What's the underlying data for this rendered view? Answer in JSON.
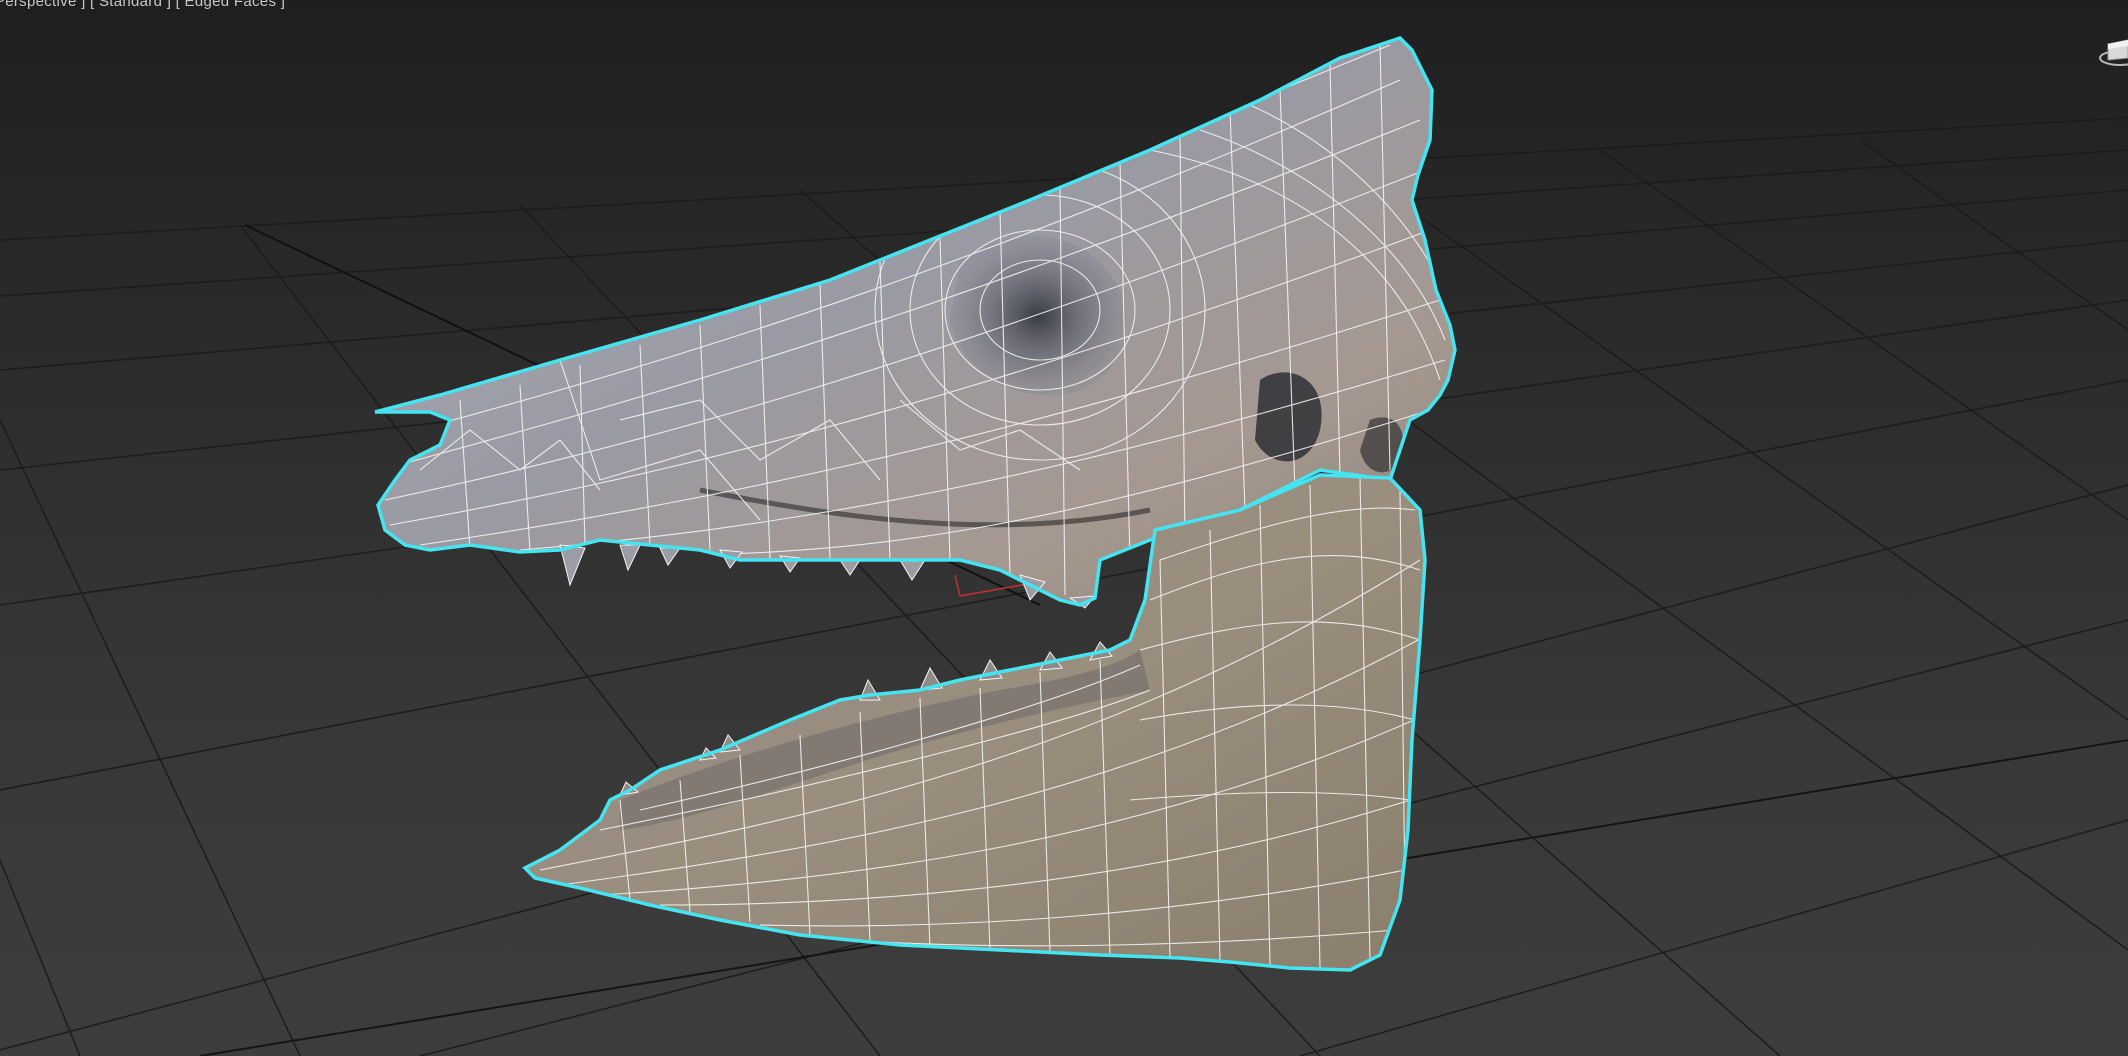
{
  "viewport": {
    "label": "[ Perspective ] [ Standard ] [ Edged Faces ]",
    "grid_color": "#1a1a1a",
    "selection_color": "#44e4f0",
    "wire_color": "#f2f2f2"
  },
  "scene": {
    "object": "skull-mesh",
    "mode": "Edged Faces",
    "selected": true
  },
  "icons": {
    "viewcube": "viewcube-icon"
  }
}
